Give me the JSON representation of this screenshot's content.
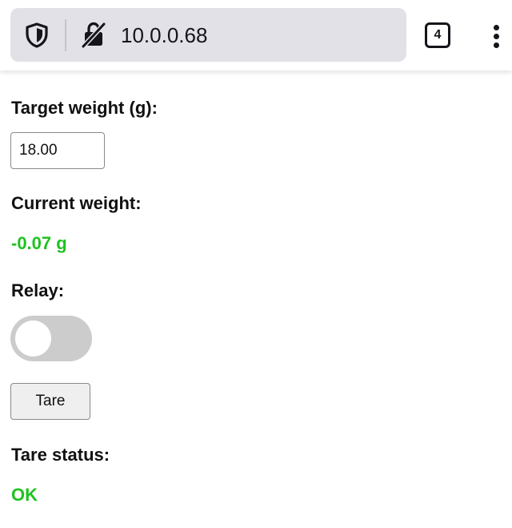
{
  "browser": {
    "url": "10.0.0.68",
    "tab_count": "4",
    "shield_icon": "shield-icon",
    "lock_icon": "insecure-lock-icon",
    "menu_icon": "kebab-menu-icon"
  },
  "form": {
    "target_weight_label": "Target weight (g):",
    "target_weight_value": "18.00",
    "current_weight_label": "Current weight:",
    "current_weight_value": "-0.07 g",
    "relay_label": "Relay:",
    "relay_on": false,
    "tare_button_label": "Tare",
    "tare_status_label": "Tare status:",
    "tare_status_value": "OK"
  },
  "colors": {
    "status_green": "#1fc21f",
    "toggle_off": "#cccccc",
    "url_bar_bg": "#e2e1e7"
  }
}
